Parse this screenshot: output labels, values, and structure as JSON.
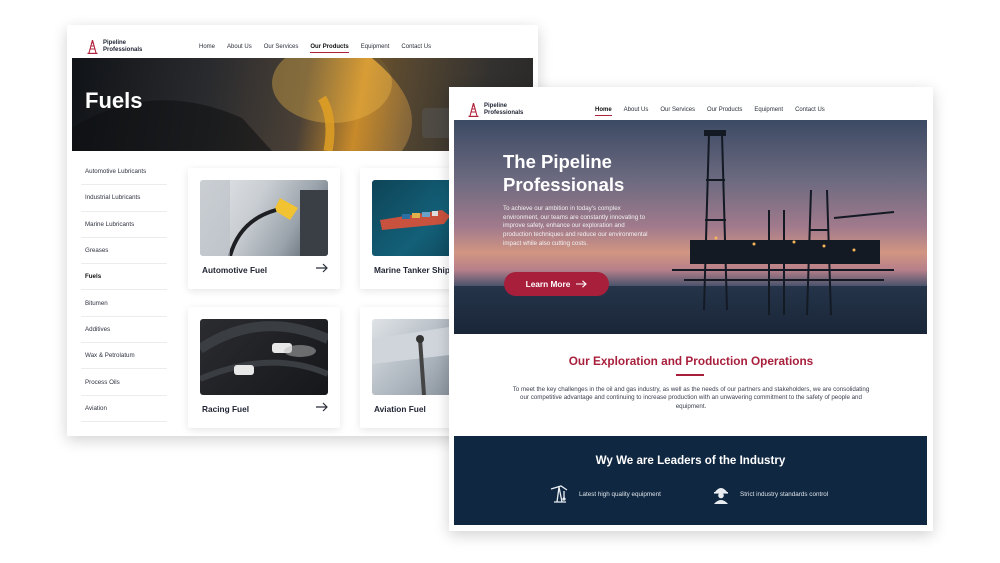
{
  "fuels_page": {
    "brand_line1": "Pipeline",
    "brand_line2": "Professionals",
    "nav": [
      "Home",
      "About Us",
      "Our Services",
      "Our Products",
      "Equipment",
      "Contact Us"
    ],
    "nav_active": "Our Products",
    "banner_title": "Fuels",
    "sidebar": [
      "Automotive Lubricants",
      "Industrial Lubricants",
      "Marine Lubricants",
      "Greases",
      "Fuels",
      "Bitumen",
      "Additives",
      "Wax & Petrolatum",
      "Process Oils",
      "Aviation"
    ],
    "sidebar_active": "Fuels",
    "cards": [
      "Automotive Fuel",
      "Marine Tanker Ships",
      "Racing Fuel",
      "Aviation Fuel"
    ]
  },
  "home_page": {
    "brand_line1": "Pipeline",
    "brand_line2": "Professionals",
    "nav": [
      "Home",
      "About Us",
      "Our Services",
      "Our Products",
      "Equipment",
      "Contact Us"
    ],
    "nav_active": "Home",
    "hero_title": "The Pipeline Professionals",
    "hero_text": "To achieve our ambition in today's complex environment, our teams are constantly innovating to improve safety, enhance our exploration and production techniques and reduce our environmental impact while also cutting costs.",
    "cta_label": "Learn More",
    "ops_title": "Our Exploration and Production Operations",
    "ops_text": "To meet the key challenges in the oil and gas industry, as well as the needs of our partners and stakeholders, we are consolidating our competitive advantage and continuing to increase production with an unwavering commitment to the safety of people and equipment.",
    "leaders_title": "Wy We are Leaders of the Industry",
    "features": [
      "Latest high quality equipment",
      "Strict industry standards control"
    ]
  },
  "icons": {
    "logo": "oil-derrick-icon",
    "card_arrow": "arrow-right-icon",
    "feature1": "pumpjack-icon",
    "feature2": "worker-hardhat-icon"
  },
  "colors": {
    "accent": "#a81f3c",
    "navy": "#0f2740",
    "text": "#1f2433"
  }
}
